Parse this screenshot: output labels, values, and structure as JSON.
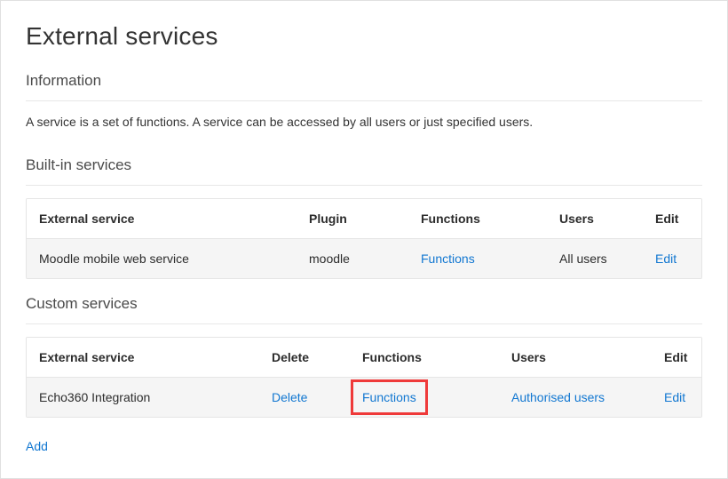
{
  "page_title": "External services",
  "information_heading": "Information",
  "information_text": "A service is a set of functions. A service can be accessed by all users or just specified users.",
  "builtin": {
    "heading": "Built-in services",
    "columns": {
      "service": "External service",
      "plugin": "Plugin",
      "functions": "Functions",
      "users": "Users",
      "edit": "Edit"
    },
    "rows": [
      {
        "service": "Moodle mobile web service",
        "plugin": "moodle",
        "functions_label": "Functions",
        "users": "All users",
        "edit_label": "Edit"
      }
    ]
  },
  "custom": {
    "heading": "Custom services",
    "columns": {
      "service": "External service",
      "delete": "Delete",
      "functions": "Functions",
      "users": "Users",
      "edit": "Edit"
    },
    "rows": [
      {
        "service": "Echo360 Integration",
        "delete_label": "Delete",
        "functions_label": "Functions",
        "users_label": "Authorised users",
        "edit_label": "Edit"
      }
    ]
  },
  "add_label": "Add"
}
